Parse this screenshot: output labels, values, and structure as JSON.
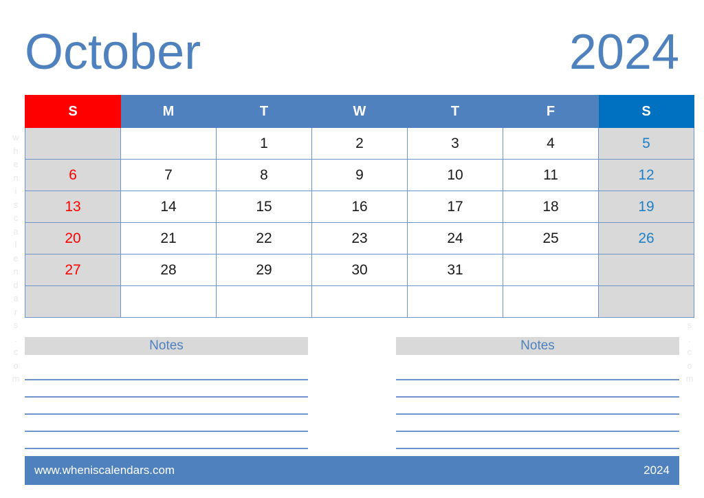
{
  "header": {
    "month": "October",
    "year": "2024"
  },
  "watermark": {
    "text": "wheniscalendars.com"
  },
  "calendar": {
    "weekday_headers": [
      {
        "label": "S",
        "kind": "sunday"
      },
      {
        "label": "M",
        "kind": "weekday"
      },
      {
        "label": "T",
        "kind": "weekday"
      },
      {
        "label": "W",
        "kind": "weekday"
      },
      {
        "label": "T",
        "kind": "weekday"
      },
      {
        "label": "F",
        "kind": "weekday"
      },
      {
        "label": "S",
        "kind": "saturday"
      }
    ],
    "weeks": [
      [
        "",
        "",
        "1",
        "2",
        "3",
        "4",
        "5"
      ],
      [
        "6",
        "7",
        "8",
        "9",
        "10",
        "11",
        "12"
      ],
      [
        "13",
        "14",
        "15",
        "16",
        "17",
        "18",
        "19"
      ],
      [
        "20",
        "21",
        "22",
        "23",
        "24",
        "25",
        "26"
      ],
      [
        "27",
        "28",
        "29",
        "30",
        "31",
        "",
        ""
      ],
      [
        "",
        "",
        "",
        "",
        "",
        "",
        ""
      ]
    ]
  },
  "notes": {
    "left_title": "Notes",
    "right_title": "Notes",
    "line_count": 5
  },
  "footer": {
    "url": "www.wheniscalendars.com",
    "year": "2024"
  },
  "colors": {
    "accent_blue": "#4E81BD",
    "saturday_blue": "#0070C0",
    "sunday_red": "#FF0000",
    "cell_gray": "#D9D9D9",
    "grid_line": "#6E93CB"
  }
}
